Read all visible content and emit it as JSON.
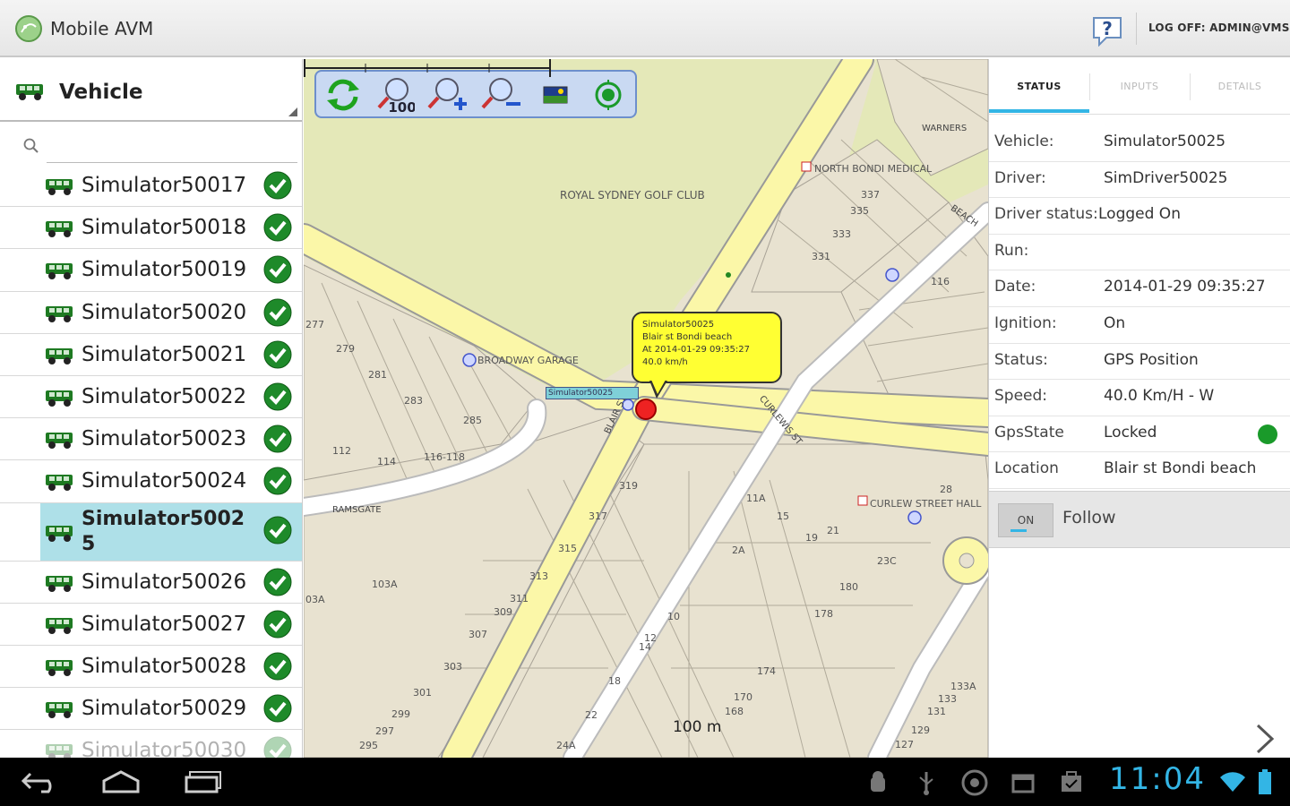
{
  "app": {
    "title": "Mobile AVM",
    "logoff": "LOG OFF: ADMIN@VMS"
  },
  "left": {
    "title": "Vehicle",
    "search_placeholder": "",
    "vehicles": [
      {
        "name": "Simulator50017",
        "ok": true
      },
      {
        "name": "Simulator50018",
        "ok": true
      },
      {
        "name": "Simulator50019",
        "ok": true
      },
      {
        "name": "Simulator50020",
        "ok": true
      },
      {
        "name": "Simulator50021",
        "ok": true
      },
      {
        "name": "Simulator50022",
        "ok": true
      },
      {
        "name": "Simulator50023",
        "ok": true
      },
      {
        "name": "Simulator50024",
        "ok": true
      },
      {
        "name": "Simulator50025",
        "ok": true,
        "selected": true
      },
      {
        "name": "Simulator50026",
        "ok": true
      },
      {
        "name": "Simulator50027",
        "ok": true
      },
      {
        "name": "Simulator50028",
        "ok": true
      },
      {
        "name": "Simulator50029",
        "ok": true
      },
      {
        "name": "Simulator50030",
        "ok": true
      }
    ]
  },
  "map": {
    "toolbar": [
      "refresh-icon",
      "zoom-100-icon",
      "zoom-in-icon",
      "zoom-out-icon",
      "map-layer-icon",
      "locate-icon"
    ],
    "zoom_label": "100",
    "callout": {
      "line1": "Simulator50025",
      "line2": "Blair st Bondi beach",
      "line3": "At 2014-01-29 09:35:27",
      "line4": "40.0 km/h"
    },
    "vehicle_label": "Simulator50025",
    "scale_label": "100 m",
    "labels": {
      "golf_club": "ROYAL SYDNEY GOLF CLUB",
      "medical": "NORTH BONDI MEDICAL",
      "garage": "BROADWAY GARAGE",
      "curlew_hall": "CURLEW STREET HALL",
      "curlewis": "CURLEWIS ST",
      "beach": "BEACH",
      "warners": "WARNERS",
      "blair": "BLAIR ST",
      "ramsgate": "RAMSGATE"
    },
    "numbers": [
      "337",
      "335",
      "333",
      "331",
      "116",
      "277",
      "279",
      "281",
      "283",
      "285",
      "112",
      "114",
      "116-118",
      "319",
      "317",
      "315",
      "313",
      "311",
      "309",
      "307",
      "303",
      "301",
      "299",
      "297",
      "295",
      "103A",
      "03A",
      "11A",
      "15",
      "19",
      "21",
      "23C",
      "28",
      "2A",
      "10",
      "12",
      "14",
      "18",
      "22",
      "24A",
      "180",
      "178",
      "174",
      "170",
      "168",
      "133A",
      "133",
      "131",
      "129",
      "127"
    ],
    "colors": {
      "road": "#fbf7a8",
      "park": "#e4e8b8",
      "land": "#e8e2d0",
      "toolbar": "#c9d9f2"
    }
  },
  "right": {
    "tabs": [
      "STATUS",
      "INPUTS",
      "DETAILS"
    ],
    "active_tab": "STATUS",
    "fields": [
      {
        "key": "Vehicle:",
        "value": "Simulator50025"
      },
      {
        "key": "Driver:",
        "value": "SimDriver50025"
      },
      {
        "key": "Driver status:",
        "value": "Logged On"
      },
      {
        "key": "Run:",
        "value": ""
      },
      {
        "key": "Date:",
        "value": "2014-01-29 09:35:27"
      },
      {
        "key": "Ignition:",
        "value": "On"
      },
      {
        "key": "Status:",
        "value": "GPS Position"
      },
      {
        "key": "Speed:",
        "value": "40.0 Km/H - W"
      },
      {
        "key": "GpsState",
        "value": "Locked"
      },
      {
        "key": "Location",
        "value": "Blair st Bondi beach"
      }
    ],
    "gps_state_color": "#1a9a2a",
    "follow": {
      "toggle": "ON",
      "label": "Follow"
    }
  },
  "system": {
    "time": "11:04",
    "accent": "#33b5e5"
  }
}
